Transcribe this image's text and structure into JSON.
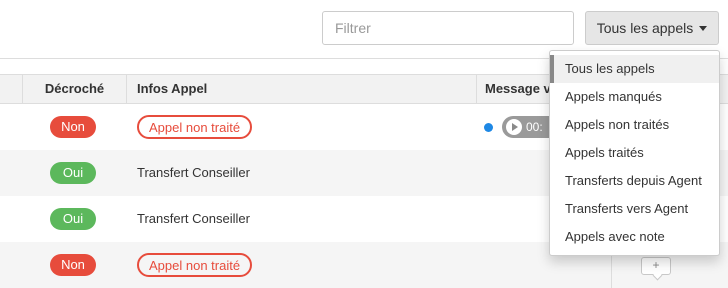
{
  "toolbar": {
    "filter_placeholder": "Filtrer",
    "filter_value": "",
    "dropdown_label": "Tous les appels"
  },
  "table": {
    "columns": {
      "decroche": "Décroché",
      "infos": "Infos Appel",
      "message": "Message v"
    },
    "rows": [
      {
        "decroche": "Non",
        "infos": "Appel non traité",
        "player_time": "00:"
      },
      {
        "decroche": "Oui",
        "infos": "Transfert Conseiller"
      },
      {
        "decroche": "Oui",
        "infos": "Transfert Conseiller"
      },
      {
        "decroche": "Non",
        "infos": "Appel non traité",
        "note_icon": "+"
      }
    ]
  },
  "menu": {
    "items": [
      {
        "label": "Tous les appels",
        "active": true
      },
      {
        "label": "Appels manqués"
      },
      {
        "label": "Appels non traités"
      },
      {
        "label": "Appels traités"
      },
      {
        "label": "Transferts depuis Agent"
      },
      {
        "label": "Transferts vers Agent"
      },
      {
        "label": "Appels avec note"
      }
    ]
  },
  "colors": {
    "danger": "#e74c3c",
    "success": "#5cb85c",
    "accent_dot": "#1e88e5",
    "row_alt": "#f5f5f5"
  },
  "icons": {
    "caret": "caret-down-icon",
    "play": "play-icon",
    "note": "add-note-icon",
    "status_dot": "unread-dot-icon"
  }
}
